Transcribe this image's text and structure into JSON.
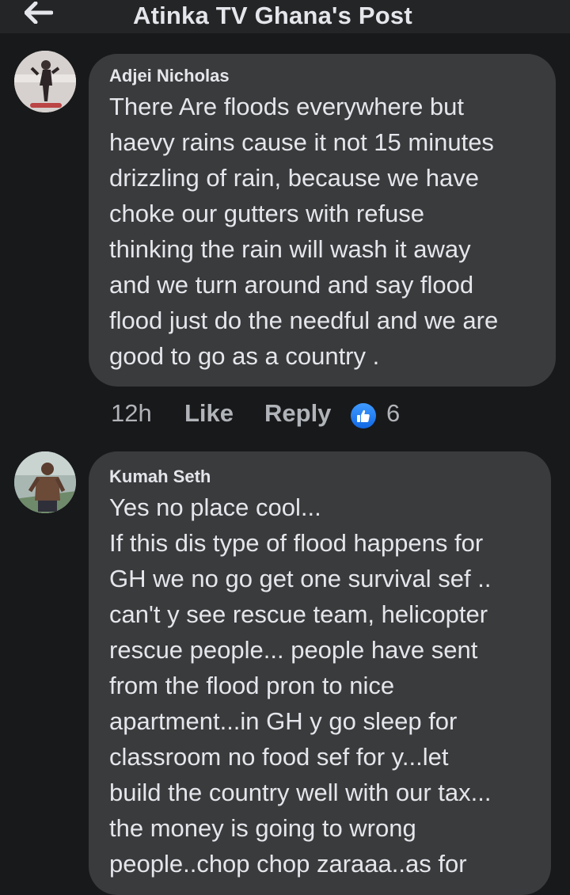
{
  "header": {
    "title": "Atinka TV Ghana's Post",
    "back_icon": "arrow-left-icon"
  },
  "comments": [
    {
      "author": "Adjei Nicholas",
      "text": "There Are floods everywhere but\nhaevy rains cause it not 15 minutes\ndrizzling of rain, because we have\nchoke our gutters with refuse\nthinking the rain will wash it away\nand we turn around and say flood\nflood just do the needful and we are\ngood to go as a country .",
      "time": "12h",
      "like_label": "Like",
      "reply_label": "Reply",
      "reaction_count": "6"
    },
    {
      "author": "Kumah Seth",
      "text": "Yes no place cool...\nIf this dis type of flood happens for\nGH we no go get one survival sef ..\ncan't y see rescue team, helicopter\nrescue people... people have sent\nfrom the flood pron to nice\napartment...in GH y go sleep for\nclassroom no food sef for y...let\nbuild the country well with our tax...\nthe money is going to wrong\npeople..chop chop zaraaa..as for"
    }
  ],
  "colors": {
    "background": "#18191a",
    "bubble": "#3a3b3c",
    "text": "#e4e6eb",
    "muted": "#b0b3b8",
    "like_blue": "#1877f2"
  }
}
